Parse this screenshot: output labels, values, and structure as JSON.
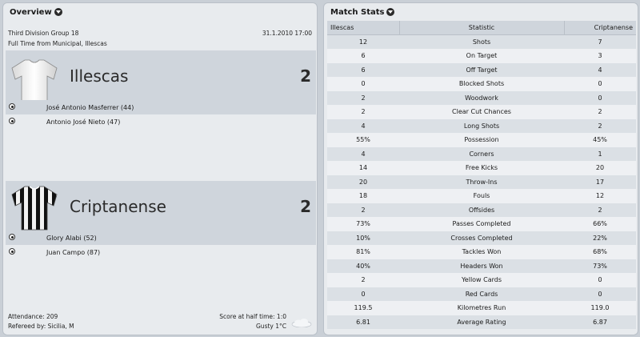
{
  "overview": {
    "title": "Overview",
    "competition": "Third Division Group 18",
    "datetime": "31.1.2010 17:00",
    "venue": "Full Time from Municipal, Illescas",
    "home": {
      "name": "Illescas",
      "score": "2",
      "shirt": "white",
      "scorers": [
        "José Antonio Masferrer (44)",
        "Antonio José Nieto (47)"
      ]
    },
    "away": {
      "name": "Criptanense",
      "score": "2",
      "shirt": "black-white-stripes",
      "scorers": [
        "Glory Alabi (52)",
        "Juan Campo (87)"
      ]
    },
    "attendance": "Attendance: 209",
    "referee": "Refereed by: Sicilia, M",
    "halftime": "Score at half time: 1:0",
    "weather": "Gusty 1°C",
    "weather_icon": "cloud-icon"
  },
  "stats": {
    "title": "Match Stats",
    "headers": {
      "home": "Illescas",
      "stat": "Statistic",
      "away": "Criptanense"
    },
    "rows": [
      {
        "home": "12",
        "stat": "Shots",
        "away": "7"
      },
      {
        "home": "6",
        "stat": "On Target",
        "away": "3"
      },
      {
        "home": "6",
        "stat": "Off Target",
        "away": "4"
      },
      {
        "home": "0",
        "stat": "Blocked Shots",
        "away": "0"
      },
      {
        "home": "2",
        "stat": "Woodwork",
        "away": "0"
      },
      {
        "home": "2",
        "stat": "Clear Cut Chances",
        "away": "2"
      },
      {
        "home": "4",
        "stat": "Long Shots",
        "away": "2"
      },
      {
        "home": "55%",
        "stat": "Possession",
        "away": "45%"
      },
      {
        "home": "4",
        "stat": "Corners",
        "away": "1"
      },
      {
        "home": "14",
        "stat": "Free Kicks",
        "away": "20"
      },
      {
        "home": "20",
        "stat": "Throw-Ins",
        "away": "17"
      },
      {
        "home": "18",
        "stat": "Fouls",
        "away": "12"
      },
      {
        "home": "2",
        "stat": "Offsides",
        "away": "2"
      },
      {
        "home": "73%",
        "stat": "Passes Completed",
        "away": "66%"
      },
      {
        "home": "10%",
        "stat": "Crosses Completed",
        "away": "22%"
      },
      {
        "home": "81%",
        "stat": "Tackles Won",
        "away": "68%"
      },
      {
        "home": "40%",
        "stat": "Headers Won",
        "away": "73%"
      },
      {
        "home": "2",
        "stat": "Yellow Cards",
        "away": "0"
      },
      {
        "home": "0",
        "stat": "Red Cards",
        "away": "0"
      },
      {
        "home": "119.5",
        "stat": "Kilometres Run",
        "away": "119.0"
      },
      {
        "home": "6.81",
        "stat": "Average Rating",
        "away": "6.87"
      }
    ]
  }
}
